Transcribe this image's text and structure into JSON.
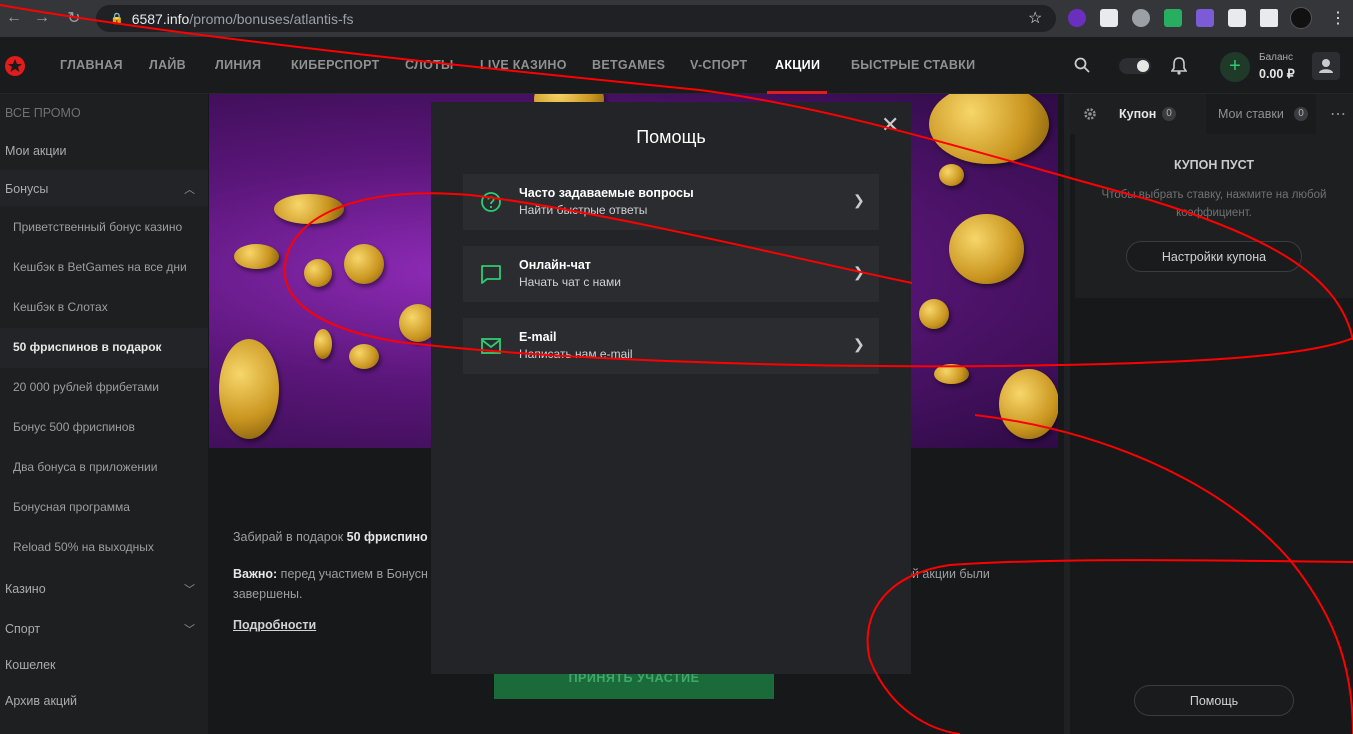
{
  "browser": {
    "url_domain": "6587.info",
    "url_path": "/promo/bonuses/atlantis-fs"
  },
  "topnav": {
    "items": [
      "ГЛАВНАЯ",
      "ЛАЙВ",
      "ЛИНИЯ",
      "КИБЕРСПОРТ",
      "СЛОТЫ",
      "LIVE КАЗИНО",
      "BETGAMES",
      "V-СПОРТ",
      "АКЦИИ",
      "БЫСТРЫЕ СТАВКИ"
    ],
    "active": "АКЦИИ",
    "balance_label": "Баланс",
    "balance_value": "0.00 ₽"
  },
  "sidebar": {
    "all_promo": "ВСЕ ПРОМО",
    "my_promos": "Мои акции",
    "bonuses": "Бонусы",
    "bonus_items": [
      "Приветственный бонус казино",
      "Кешбэк в BetGames на все дни",
      "Кешбэк в Слотах",
      "50 фриспинов в подарок",
      "20 000 рублей фрибетами",
      "Бонус 500 фриспинов",
      "Два бонуса в приложении",
      "Бонусная программа",
      "Reload 50% на выходных"
    ],
    "active_item": "50 фриспинов в подарок",
    "casino": "Казино",
    "sport": "Спорт",
    "wallet": "Кошелек",
    "archive": "Архив акций"
  },
  "promo": {
    "text1_prefix": "Забирай в подарок ",
    "text1_bold": "50 фриспино",
    "text2_bold": "Важно:",
    "text2": " перед участием в Бонусн",
    "text2_tail": "ой акции были",
    "text2_line2": "завершены.",
    "details": "Подробности",
    "join_button": "ПРИНЯТЬ УЧАСТИЕ"
  },
  "right_panel": {
    "coupon_tab": "Купон",
    "coupon_count": "0",
    "bets_tab": "Мои ставки",
    "bets_count": "0",
    "empty_title": "КУПОН ПУСТ",
    "empty_text": "Чтобы выбрать ставку, нажмите на любой коэффициент.",
    "settings_button": "Настройки купона",
    "help_button": "Помощь"
  },
  "modal": {
    "title": "Помощь",
    "rows": [
      {
        "title": "Часто задаваемые вопросы",
        "subtitle": "Найти быстрые ответы",
        "icon": "question-icon"
      },
      {
        "title": "Онлайн-чат",
        "subtitle": "Начать чат с нами",
        "icon": "chat-icon"
      },
      {
        "title": "E-mail",
        "subtitle": "Написать нам e-mail",
        "icon": "mail-icon"
      }
    ]
  },
  "colors": {
    "accent_red": "#e21b1b",
    "accent_green": "#2ecc71",
    "join_button_bg": "#1b6b3a",
    "scribble": "#ff0000"
  }
}
